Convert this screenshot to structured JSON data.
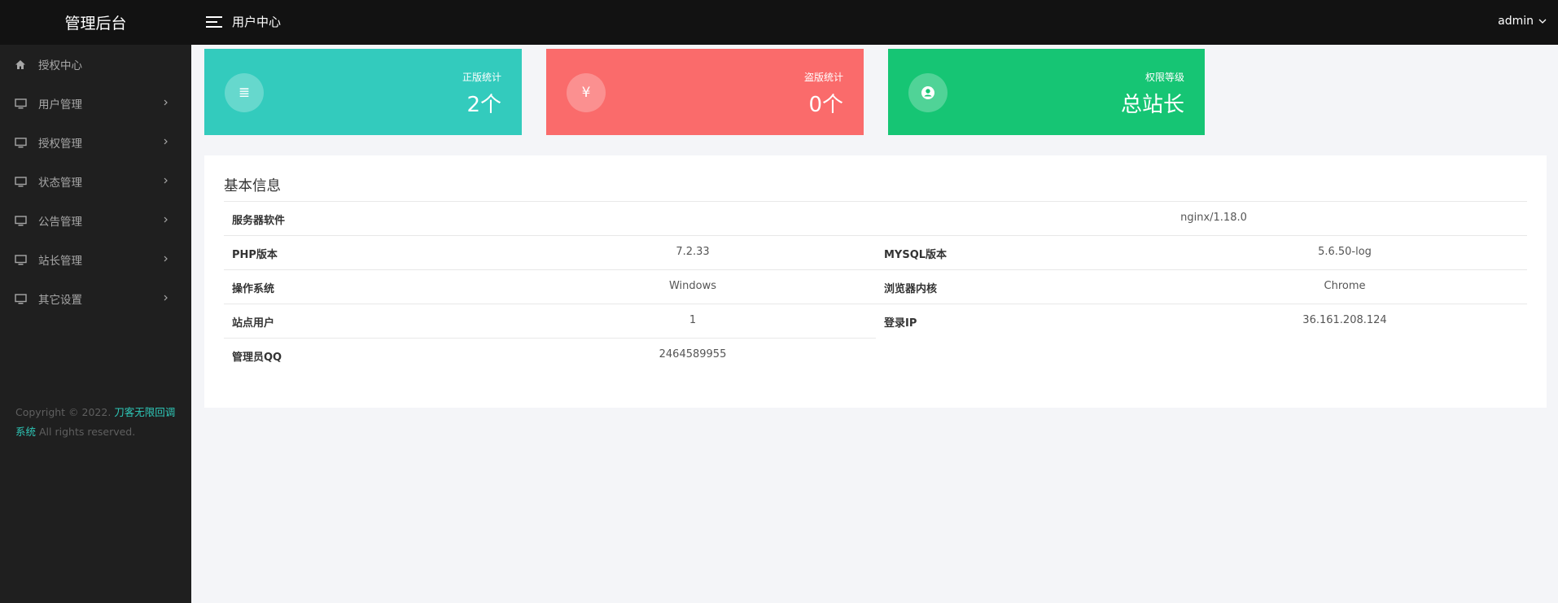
{
  "header": {
    "brand": "管理后台",
    "page_title": "用户中心",
    "user": "admin"
  },
  "sidebar": {
    "items": [
      {
        "label": "授权中心",
        "icon": "home-icon"
      },
      {
        "label": "用户管理",
        "icon": "monitor-icon"
      },
      {
        "label": "授权管理",
        "icon": "monitor-icon"
      },
      {
        "label": "状态管理",
        "icon": "monitor-icon"
      },
      {
        "label": "公告管理",
        "icon": "monitor-icon"
      },
      {
        "label": "站长管理",
        "icon": "monitor-icon"
      },
      {
        "label": "其它设置",
        "icon": "monitor-icon"
      }
    ],
    "copyright_prefix": "Copyright © 2022.",
    "copyright_link_1": "刀客无限回调",
    "copyright_link_2": "系统",
    "copyright_suffix": "All rights reserved."
  },
  "stats": [
    {
      "label": "正版统计",
      "value": "2个",
      "icon_glyph": "≣",
      "icon": "list-icon",
      "color": "#33cbbd"
    },
    {
      "label": "盗版统计",
      "value": "0个",
      "icon_glyph": "¥",
      "icon": "yen-icon",
      "color": "#fa6b6b"
    },
    {
      "label": "权限等级",
      "value": "总站长",
      "icon_glyph": "",
      "icon": "user-circle-icon",
      "color": "#16c574"
    }
  ],
  "basic_info": {
    "title": "基本信息",
    "server_software_label": "服务器软件",
    "server_software_value": "nginx/1.18.0",
    "php_label": "PHP版本",
    "php_value": "7.2.33",
    "mysql_label": "MYSQL版本",
    "mysql_value": "5.6.50-log",
    "os_label": "操作系统",
    "os_value": "Windows",
    "browser_label": "浏览器内核",
    "browser_value": "Chrome",
    "site_users_label": "站点用户",
    "site_users_value": "1",
    "login_ip_label": "登录IP",
    "login_ip_value": "36.161.208.124",
    "admin_qq_label": "管理员QQ",
    "admin_qq_value": "2464589955"
  }
}
